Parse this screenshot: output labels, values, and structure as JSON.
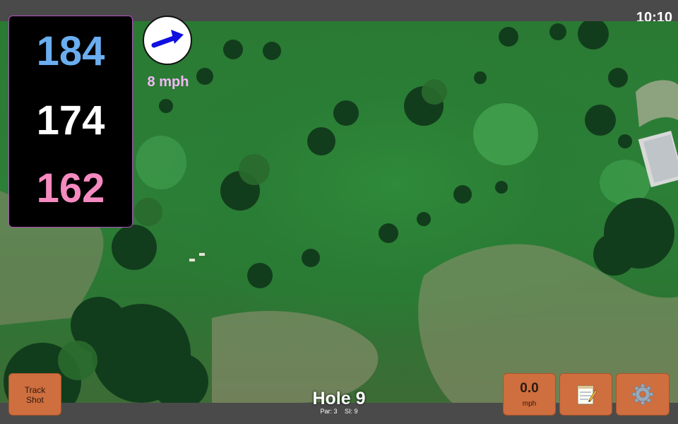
{
  "status_bar": {
    "time": "10:10"
  },
  "yardages": {
    "back": "184",
    "center": "174",
    "front": "162"
  },
  "wind": {
    "speed": "8 mph",
    "direction_icon": "arrow-east-northeast-icon"
  },
  "buttons": {
    "track_shot": {
      "label": "Track Shot"
    },
    "speed": {
      "value": "0.0",
      "unit": "mph"
    },
    "notes": {
      "icon": "notepad-icon"
    },
    "settings": {
      "icon": "gear-icon"
    }
  },
  "hole": {
    "title": "Hole 9",
    "par": "Par: 3",
    "si": "SI: 9"
  },
  "colors": {
    "back_yardage": "#6aaef0",
    "center_yardage": "#ffffff",
    "front_yardage": "#f58ac0",
    "button_orange": "#cf6e3e",
    "wind_arrow": "#1010e0",
    "panel_border": "#b14ec0"
  }
}
